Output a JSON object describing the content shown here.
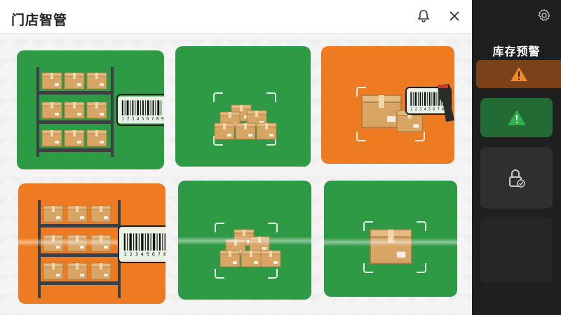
{
  "header": {
    "title": "门店智管"
  },
  "sidebar": {
    "title": "库存预警",
    "items": [
      {
        "name": "warning-orange",
        "icon": "warning-icon",
        "color": "#e07a1e",
        "state": "active"
      },
      {
        "name": "warning-green",
        "icon": "warning-icon",
        "color": "#2f9a45",
        "state": "normal"
      },
      {
        "name": "lock-check",
        "icon": "lock-icon",
        "color": "#3a3a3a",
        "state": "normal"
      },
      {
        "name": "empty-slot",
        "icon": "",
        "color": "#262626",
        "state": "empty"
      }
    ]
  },
  "tiles": [
    {
      "name": "shelf-barcode",
      "status": "green"
    },
    {
      "name": "boxes-scan",
      "status": "green"
    },
    {
      "name": "box-scanner",
      "status": "orange"
    },
    {
      "name": "shelf-barcode",
      "status": "orange"
    },
    {
      "name": "boxes-scan",
      "status": "green"
    },
    {
      "name": "box-scan",
      "status": "green"
    }
  ],
  "colors": {
    "green": "#2f9a45",
    "orange": "#ee7b22",
    "sidebar_bg": "#1f1f1f",
    "box": "#d9a76a"
  }
}
